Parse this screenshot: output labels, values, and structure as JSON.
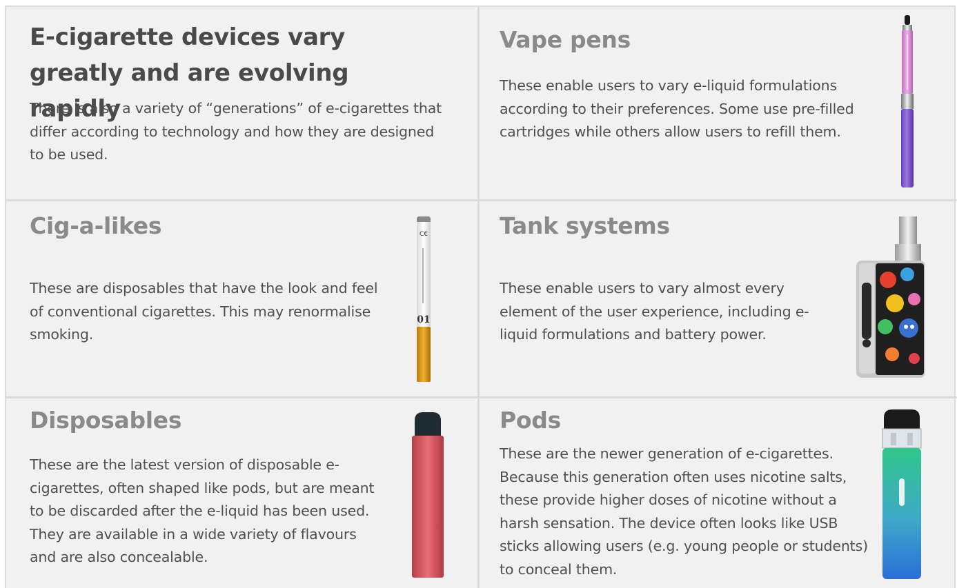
{
  "intro": {
    "title": "E-cigarette devices vary greatly and are evolving rapidly",
    "text": "There is also a variety of “generations” of e-cigarettes that differ according to technology and how they are designed to be used."
  },
  "vape_pens": {
    "title": "Vape pens",
    "text": "These enable users to vary e-liquid formulations according to their preferences. Some use pre-filled cartridges while others allow users to refill them.",
    "image_icon": "vape-pen-icon"
  },
  "cig_a_likes": {
    "title": "Cig-a-likes",
    "text": "These are disposables that have the look and feel of conventional cigarettes. This may renormalise smoking.",
    "image_icon": "cig-a-like-icon"
  },
  "tank_systems": {
    "title": "Tank systems",
    "text": "These enable users to vary almost every element of the user experience, including e-liquid formulations and battery power.",
    "image_icon": "tank-mod-icon"
  },
  "disposables": {
    "title": "Disposables",
    "text": "These are the latest version of disposable e-cigarettes, often shaped like pods, but are meant to be discarded after the e-liquid has been used. They are available in a wide variety of flavours and are also concealable.",
    "image_icon": "disposable-vape-icon"
  },
  "pods": {
    "title": "Pods",
    "text": "These are the newer generation of e-cigarettes. Because this generation often uses nicotine salts, these provide higher doses of nicotine without a harsh sensation. The device often looks like USB sticks allowing users (e.g. young people or students) to conceal them.",
    "image_icon": "pod-device-icon"
  },
  "colors": {
    "background": "#f1f1f1",
    "divider": "#dcdcdc",
    "title_main": "#4a4a4a",
    "title_section": "#8a8a8a",
    "body_text": "#505050"
  }
}
